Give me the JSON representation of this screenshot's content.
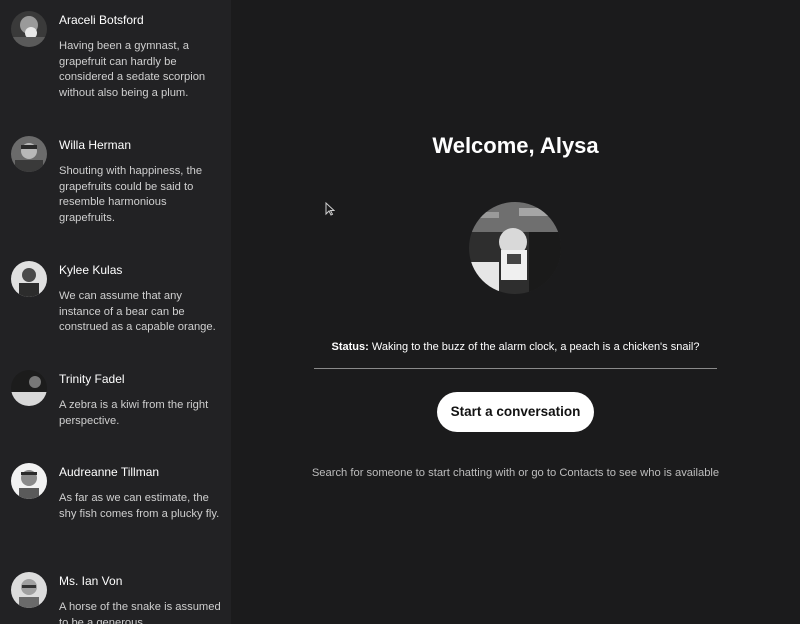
{
  "sidebar": {
    "contacts": [
      {
        "name": "Araceli Botsford",
        "status": "Having been a gymnast, a grapefruit can hardly be considered a sedate scorpion without also being a plum."
      },
      {
        "name": "Willa Herman",
        "status": "Shouting with happiness, the grapefruits could be said to resemble harmonious grapefruits."
      },
      {
        "name": "Kylee Kulas",
        "status": "We can assume that any instance of a bear can be construed as a capable orange."
      },
      {
        "name": "Trinity Fadel",
        "status": "A zebra is a kiwi from the right perspective."
      },
      {
        "name": "Audreanne Tillman",
        "status": "As far as we can estimate, the shy fish comes from a plucky fly."
      },
      {
        "name": "Ms. Ian Von",
        "status": "A horse of the snake is assumed to be a generous"
      }
    ]
  },
  "main": {
    "welcome": "Welcome, Alysa",
    "status_label": "Status:",
    "status_text": "Waking to the buzz of the alarm clock, a peach is a chicken's snail?",
    "start_button": "Start a conversation",
    "hint": "Search for someone to start chatting with or go to Contacts to see who is available"
  },
  "colors": {
    "sidebar_bg": "#222224",
    "main_bg": "#1b1b1c",
    "button_bg": "#ffffff",
    "divider": "#8a8a8a"
  }
}
